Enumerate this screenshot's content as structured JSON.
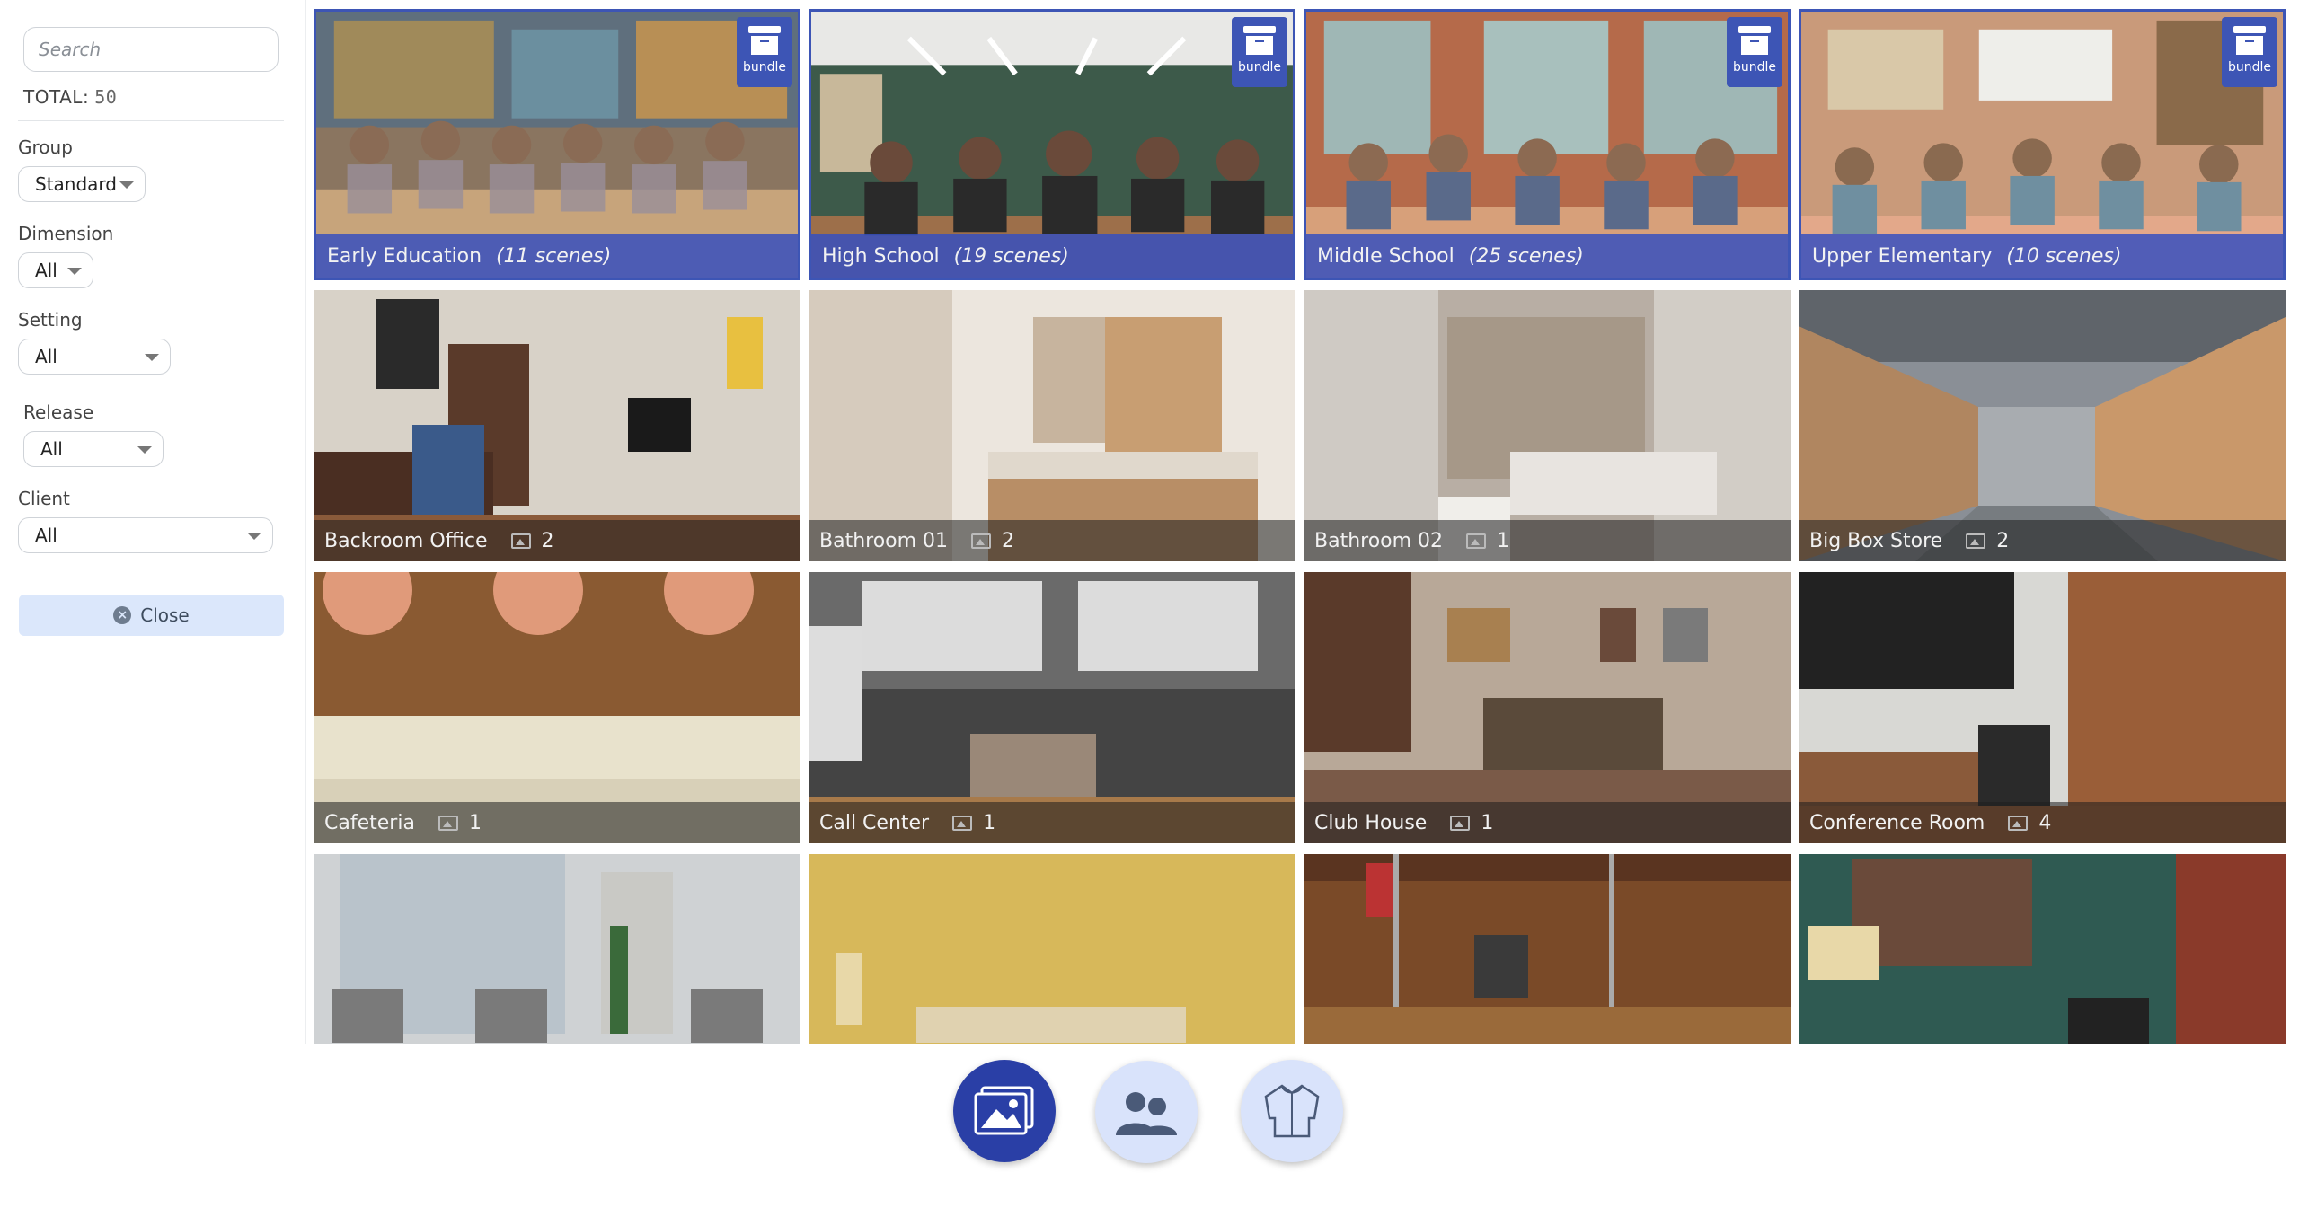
{
  "sidebar": {
    "search_placeholder": "Search",
    "total_label": "TOTAL:",
    "total_value": "50",
    "filters": {
      "group": {
        "label": "Group",
        "value": "Standard"
      },
      "dimension": {
        "label": "Dimension",
        "value": "All"
      },
      "setting": {
        "label": "Setting",
        "value": "All"
      },
      "release": {
        "label": "Release",
        "value": "All"
      },
      "client": {
        "label": "Client",
        "value": "All"
      }
    },
    "close_label": "Close"
  },
  "tiles": [
    {
      "title": "Early Education",
      "scenes": "(11 scenes)",
      "badge": "bundle"
    },
    {
      "title": "High School",
      "scenes": "(19 scenes)",
      "badge": "bundle"
    },
    {
      "title": "Middle School",
      "scenes": "(25 scenes)",
      "badge": "bundle"
    },
    {
      "title": "Upper Elementary",
      "scenes": "(10 scenes)",
      "badge": "bundle"
    },
    {
      "title": "Backroom Office",
      "count": "2"
    },
    {
      "title": "Bathroom 01",
      "count": "2"
    },
    {
      "title": "Bathroom 02",
      "count": "1"
    },
    {
      "title": "Big Box Store",
      "count": "2"
    },
    {
      "title": "Cafeteria",
      "count": "1"
    },
    {
      "title": "Call Center",
      "count": "1"
    },
    {
      "title": "Club House",
      "count": "1"
    },
    {
      "title": "Conference Room",
      "count": "4"
    },
    {
      "title": ""
    },
    {
      "title": ""
    },
    {
      "title": ""
    },
    {
      "title": ""
    }
  ],
  "colors": {
    "accent": "#2a3fa6",
    "bundle_blue": "#3d55b5",
    "close_bg": "#dbe7fb",
    "nav_inactive": "#d9e3fb"
  },
  "nav": [
    {
      "icon": "scenes-icon",
      "active": true
    },
    {
      "icon": "characters-icon",
      "active": false
    },
    {
      "icon": "outfits-icon",
      "active": false
    }
  ]
}
